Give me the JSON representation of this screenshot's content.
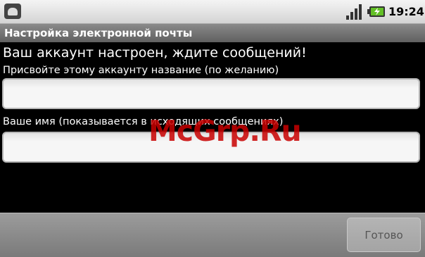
{
  "statusbar": {
    "time": "19:24",
    "icons": [
      "android-icon",
      "signal-icon",
      "battery-charging-icon"
    ]
  },
  "titlebar": {
    "title": "Настройка электронной почты"
  },
  "main": {
    "headline": "Ваш аккаунт настроен, ждите сообщений!",
    "account_name_label": "Присвойте этому аккаунту название (по желанию)",
    "account_name_value": "",
    "your_name_label": "Ваше имя (показывается в исходящих сообщениях)",
    "your_name_value": ""
  },
  "watermark": "McGrp.Ru",
  "buttons": {
    "done": "Готово"
  },
  "colors": {
    "watermark": "#c80000",
    "titlebar": "#6e6e6e",
    "battery": "#63c026"
  }
}
